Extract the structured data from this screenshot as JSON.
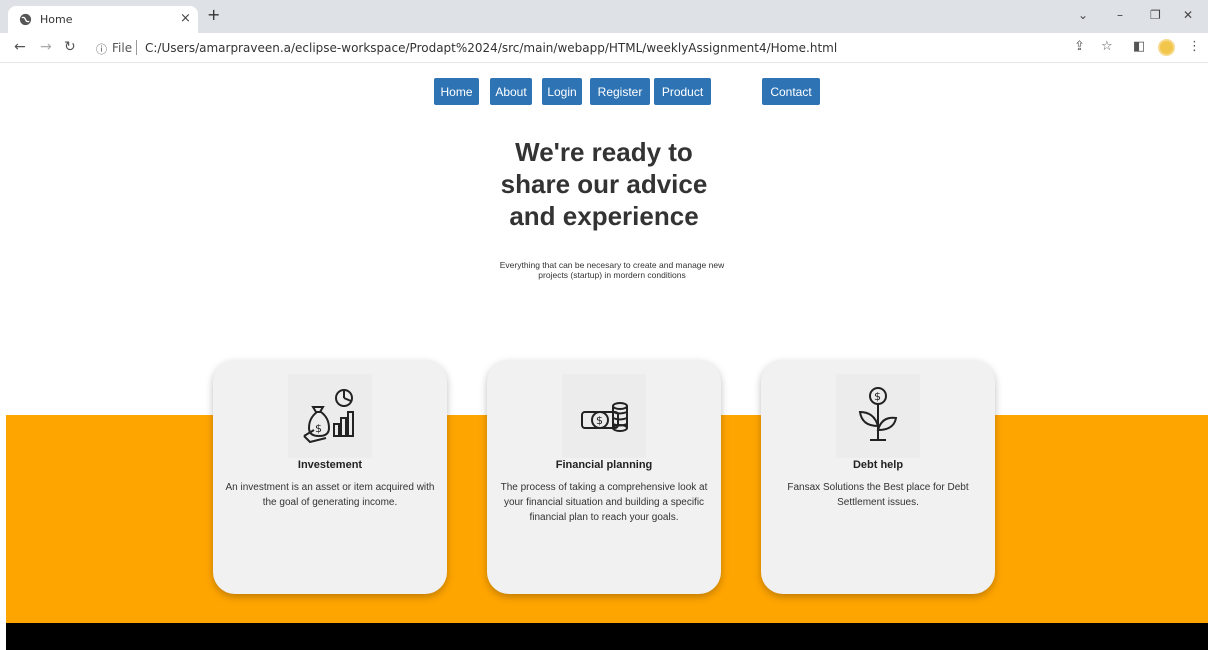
{
  "browser": {
    "tab_title": "Home",
    "tab_close": "×",
    "new_tab": "+",
    "file_label": "File",
    "url": "C:/Users/amarpraveen.a/eclipse-workspace/Prodapt%2024/src/main/webapp/HTML/weeklyAssignment4/Home.html"
  },
  "nav": {
    "items": [
      "Home",
      "About",
      "Login",
      "Register",
      "Product",
      "Contact"
    ]
  },
  "hero": {
    "title_line1": "We're ready to",
    "title_line2": "share our advice",
    "title_line3": "and experience",
    "subtitle_line1": "Everything that can be necesary to create and manage new",
    "subtitle_line2": "projects (startup) in mordern conditions"
  },
  "cards": [
    {
      "icon": "investment-icon",
      "title": "Investement",
      "text": "An investment is an asset or item acquired with the goal of generating income."
    },
    {
      "icon": "coins-icon",
      "title": "Financial planning",
      "text": "The process of taking a comprehensive look at your financial situation and building a specific financial plan to reach your goals."
    },
    {
      "icon": "money-plant-icon",
      "title": "Debt help",
      "text": "Fansax Solutions the Best place for Debt Settlement issues."
    }
  ],
  "colors": {
    "nav_button": "#2e74b5",
    "band": "#ffa500",
    "footer": "#000000"
  }
}
